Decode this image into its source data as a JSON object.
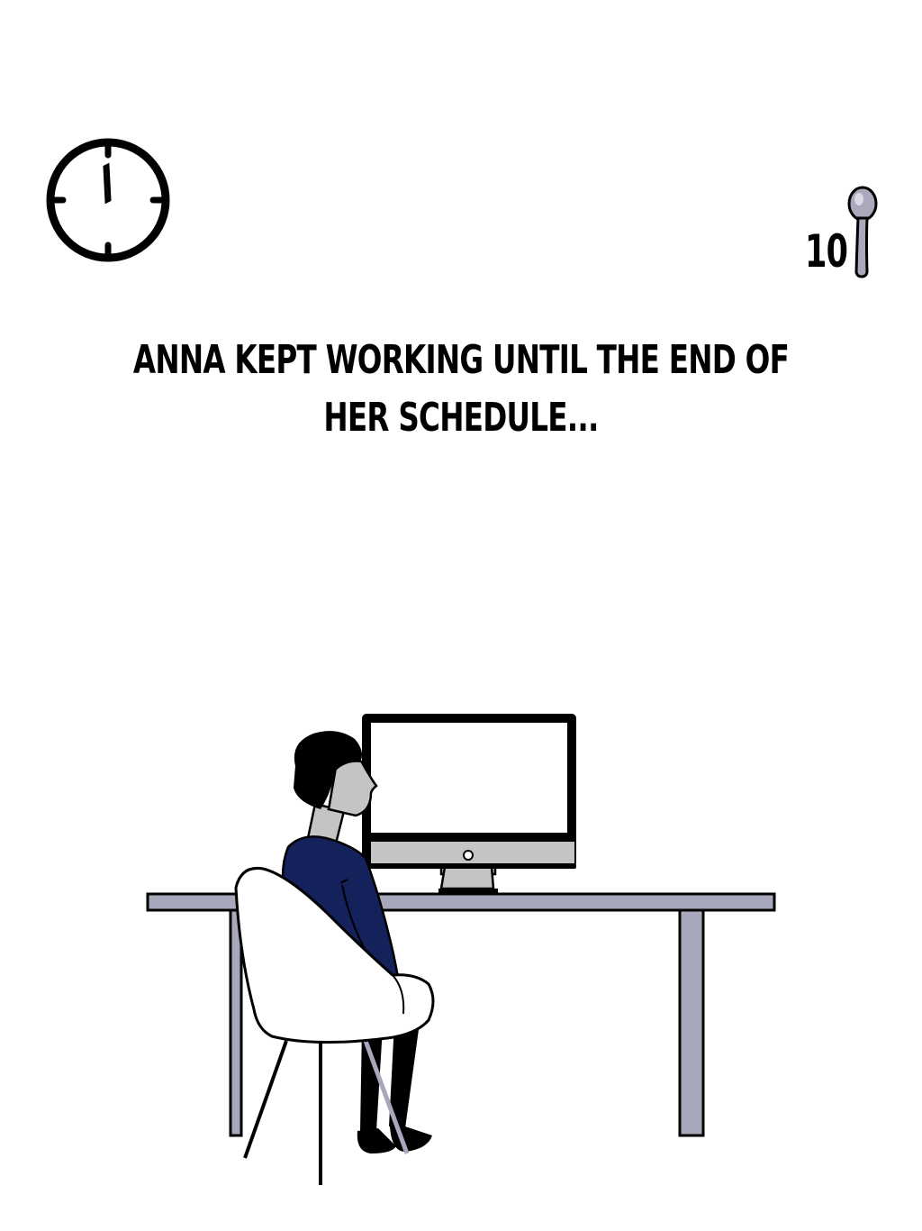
{
  "hud": {
    "clock_icon": "clock-icon",
    "spoon_count": "10",
    "spoon_icon": "spoon-icon"
  },
  "narration": {
    "text": "ANNA KEPT WORKING UNTIL THE END OF HER SCHEDULE..."
  },
  "scene": {
    "description_icons": [
      "desk",
      "monitor",
      "chair",
      "person"
    ],
    "colors": {
      "desk": "#a8a8bc",
      "shirt": "#14215a",
      "skin": "#c4c4c4",
      "hair": "#000000",
      "chair": "#ffffff",
      "monitor_stand": "#c4c4c4",
      "spoon": "#a9a9bb"
    }
  }
}
